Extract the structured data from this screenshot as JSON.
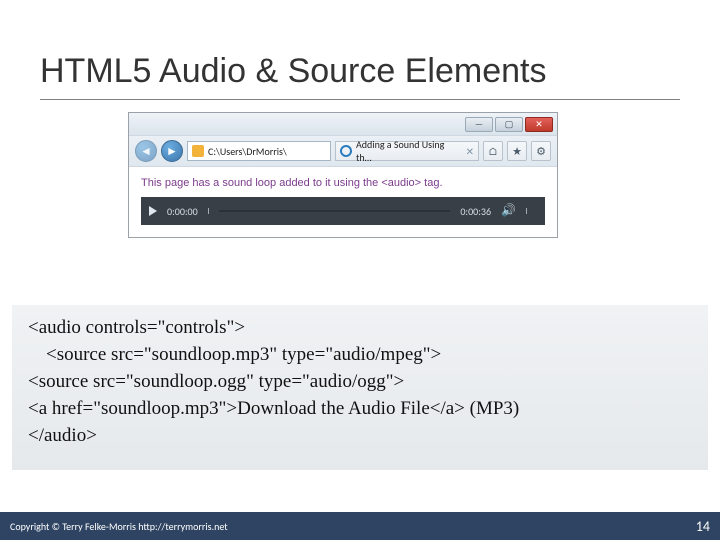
{
  "slide": {
    "title": "HTML5 Audio & Source Elements"
  },
  "browser": {
    "address_bar": "C:\\Users\\DrMorris\\",
    "tab_label": "Adding a Sound Using th…",
    "page_text": "This page has a sound loop added to it using the <audio> tag.",
    "player": {
      "elapsed": "0:00:00",
      "duration": "0:00:36"
    }
  },
  "code": {
    "l1": "<audio controls=\"controls\">",
    "l2": "<source src=\"soundloop.mp3\" type=\"audio/mpeg\">",
    "l3": "<source src=\"soundloop.ogg\" type=\"audio/ogg\">",
    "l4": "<a href=\"soundloop.mp3\">Download the Audio File</a> (MP3)",
    "l5": "</audio>"
  },
  "footer": {
    "copyright": "Copyright © Terry Felke-Morris http://terrymorris.net",
    "page_number": "14"
  }
}
